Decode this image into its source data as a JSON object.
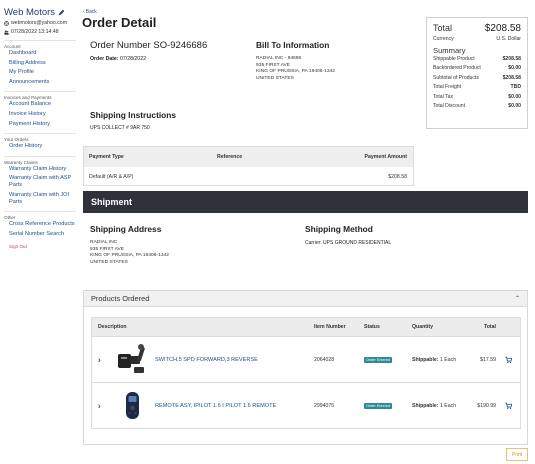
{
  "sidebar": {
    "brand": "Web Motors",
    "email": "webmotors@yahoo.com",
    "datetime": "07/28/2022 13:14:48",
    "sections": [
      {
        "title": "Account",
        "items": [
          "Dashboard",
          "Billing Address",
          "My Profile",
          "Announcements"
        ]
      },
      {
        "title": "Invoices and Payments",
        "items": [
          "Account Balance",
          "Invoice History",
          "Payment History"
        ]
      },
      {
        "title": "Your Orders",
        "items": [
          "Order History"
        ]
      },
      {
        "title": "Warranty Claims",
        "items": [
          "Warranty Claim History",
          "Warranty Claim with ASP Parts",
          "Warranty Claim with JOI Parts"
        ]
      },
      {
        "title": "Other",
        "items": [
          "Cross Reference Products",
          "Serial Number Search"
        ]
      }
    ],
    "signout": "Sign Out"
  },
  "header": {
    "back": "Back",
    "title": "Order Detail"
  },
  "order": {
    "number_label": "Order Number",
    "number": "SO-9246686",
    "date_label": "Order Date:",
    "date": "07/28/2022"
  },
  "bill_to": {
    "title": "Bill To Information",
    "lines": [
      "RADIAL INC - 84695",
      "935 FIRST AVE",
      "KING OF PRUSSIA, PA 19406-1342",
      "UNITED STATES"
    ]
  },
  "totals": {
    "label": "Total",
    "value": "$208.58",
    "currency_label": "Currency",
    "currency": "U.S. Dollar",
    "summary_label": "Summary",
    "rows": [
      {
        "label": "Shippable Product",
        "value": "$208.58"
      },
      {
        "label": "Backordered Product",
        "value": "$0.00"
      },
      {
        "label": "Subtotal of Products",
        "value": "$208.58"
      },
      {
        "label": "Total Freight",
        "value": "TBD"
      },
      {
        "label": "Total Tax",
        "value": "$0.00"
      },
      {
        "label": "Total Discount",
        "value": "$0.00"
      }
    ]
  },
  "shipping_instructions": {
    "title": "Shipping Instructions",
    "text": "UPS COLLECT # 9AR 750"
  },
  "payment": {
    "headers": [
      "Payment Type",
      "Reference",
      "Payment Amount"
    ],
    "row": [
      "Default (A/R & A/P)",
      "",
      "$208.58"
    ]
  },
  "shipment": {
    "band_title": "Shipment",
    "address_title": "Shipping Address",
    "address_lines": [
      "RADIAL INC",
      "935 FIRST AVE",
      "KING OF PRUSSIA, PA 19406-1342",
      "UNITED STATES"
    ],
    "method_title": "Shipping Method",
    "method": "Carrier: UPS GROUND RESIDENTIAL"
  },
  "products": {
    "title": "Products Ordered",
    "headers": [
      "Description",
      "Item Number",
      "Status",
      "Quantity",
      "Total"
    ],
    "rows": [
      {
        "name": "SWITCH,5 SPD FORWARD,3 REVERSE",
        "item": "2064028",
        "status": "Order Entered",
        "qty_label": "Shippable:",
        "qty": "1  Each",
        "total": "$17.59"
      },
      {
        "name": "REMOTE ASY, IPILOT 1.6 I PILOT 1.6 REMOTE",
        "item": "2994075",
        "status": "Order Entered",
        "qty_label": "Shippable:",
        "qty": "1  Each",
        "total": "$190.99"
      }
    ]
  },
  "print_label": "Print",
  "colors": {
    "brand": "#1f3d70",
    "link": "#1f4f8f",
    "band": "#2f3238",
    "status": "#2a8a9a",
    "print_border": "#e8c56a"
  }
}
